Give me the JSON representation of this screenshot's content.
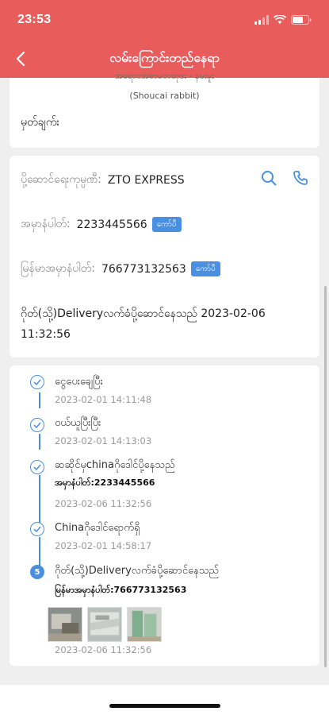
{
  "status_bar": {
    "time": "23:53"
  },
  "nav": {
    "title": "လမ်းကြောင်းတည်နေရာ"
  },
  "product": {
    "clipped_line": "အရောင်အစာမတ်ဆိုဒ်း - နမ်းမူး",
    "subtitle": "(Shoucai rabbit)",
    "remark_label": "မှတ်ချက်း"
  },
  "shipping": {
    "company_label": "ပို့ဆောင်ရေးကုမ္ပဏီ:",
    "company_value": "ZTO EXPRESS",
    "order_label": "အမှာနံပါတ်:",
    "order_value": "2233445566",
    "copy_label": "ကော်ပီ",
    "mm_order_label": "မြန်မာအမှာနံပါတ်:",
    "mm_order_value": "766773132563",
    "status_line": "ဂိုတ်(သို့)Deliveryလက်ခံပို့ဆောင်နေသည်  2023-02-06 11:32:56"
  },
  "timeline": [
    {
      "title": "ငွေပေးချေပြီး",
      "sub": "",
      "time": "2023-02-01 14:11:48"
    },
    {
      "title": "ဝယ်ယူပြီးပြီး",
      "sub": "",
      "time": "2023-02-01 14:13:03"
    },
    {
      "title": "ဆဆိုင်မှchinaဂိုဒေါင်ပို့နေသည်",
      "sub": "အမှာနံပါတ်:2233445566",
      "time": "2023-02-06 11:32:56"
    },
    {
      "title": "Chinaဂိုဒေါင်ရောက်ရှိ",
      "sub": "",
      "time": "2023-02-01 14:58:17"
    },
    {
      "title": "ဂိုတ်(သို့)Deliveryလက်ခံပို့ဆောင်နေသည်",
      "sub": "မြန်မာအမှာနံပါတ်:766773132563",
      "time": "2023-02-06 11:32:56",
      "step": "5"
    }
  ],
  "icons": {
    "search": "search-icon",
    "phone": "phone-icon",
    "check": "check-circle-icon"
  },
  "colors": {
    "header": "#e85c5c",
    "accent": "#4a90e2"
  }
}
